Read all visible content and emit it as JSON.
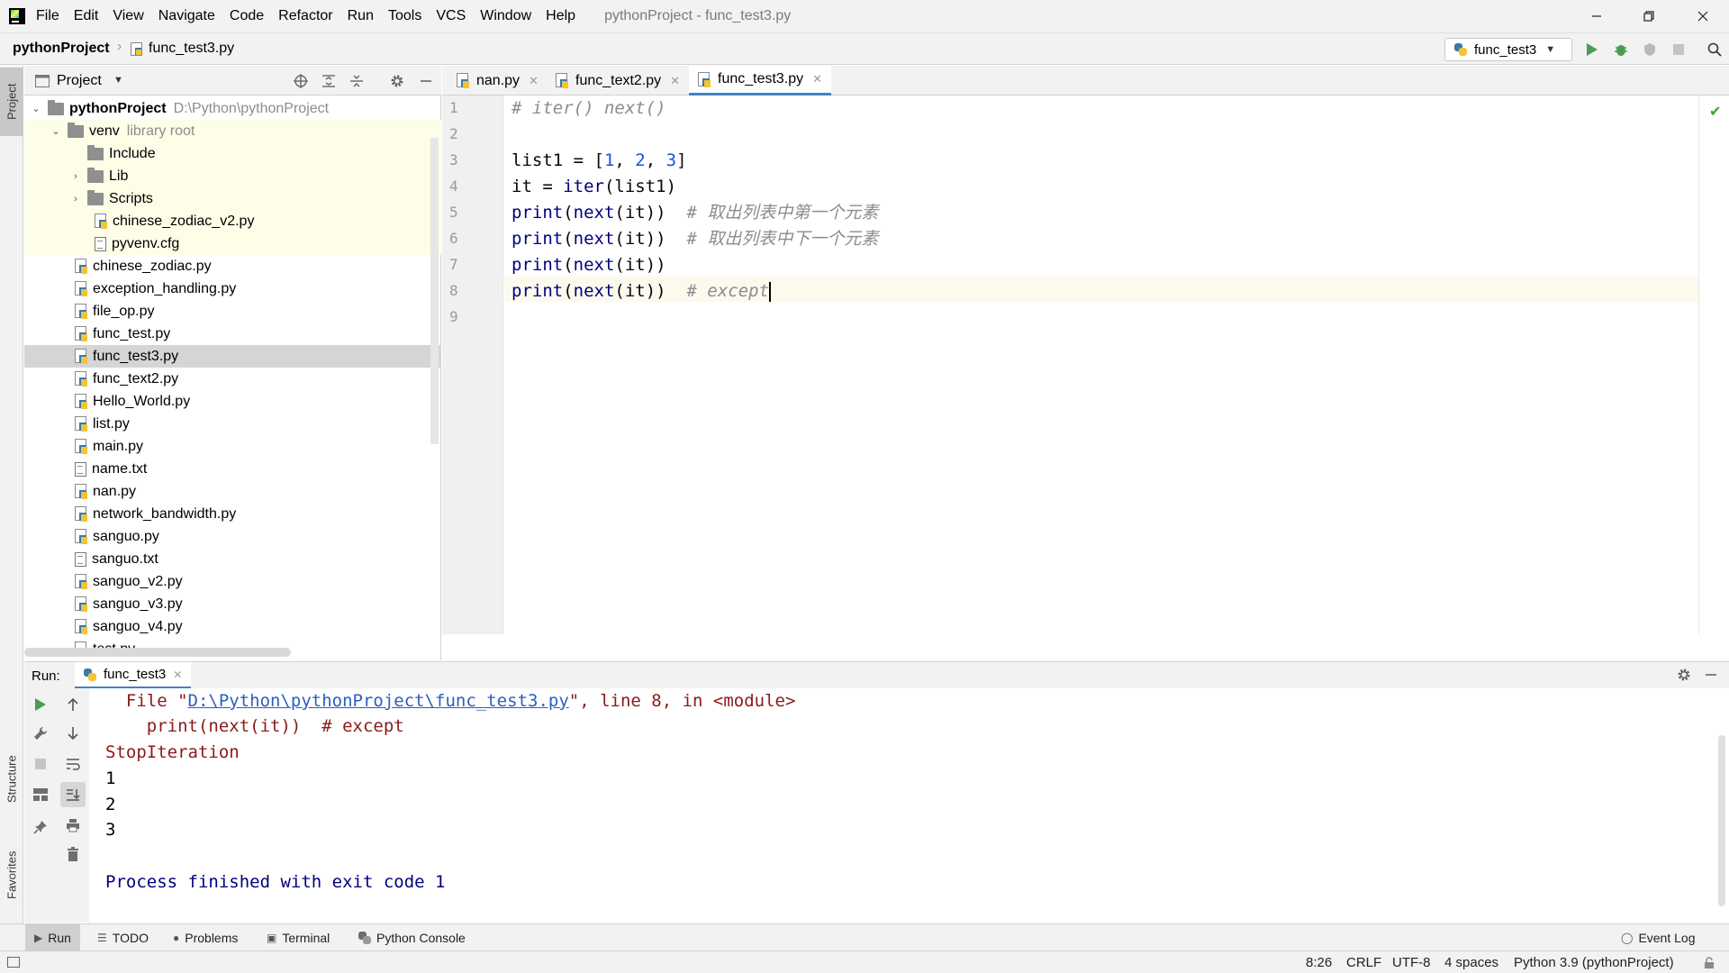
{
  "menubar": {
    "items": [
      "File",
      "Edit",
      "View",
      "Navigate",
      "Code",
      "Refactor",
      "Run",
      "Tools",
      "VCS",
      "Window",
      "Help"
    ],
    "title": "pythonProject - func_test3.py"
  },
  "navbar": {
    "project": "pythonProject",
    "file": "func_test3.py",
    "run_config": "func_test3"
  },
  "left_stripe": {
    "project": "Project",
    "structure": "Structure",
    "favorites": "Favorites"
  },
  "project_panel": {
    "title": "Project",
    "root": {
      "name": "pythonProject",
      "path": "D:\\Python\\pythonProject"
    },
    "venv": {
      "name": "venv",
      "hint": "library root"
    },
    "venv_children": [
      {
        "name": "Include",
        "type": "folder"
      },
      {
        "name": "Lib",
        "type": "folder"
      },
      {
        "name": "Scripts",
        "type": "folder"
      },
      {
        "name": "chinese_zodiac_v2.py",
        "type": "py"
      },
      {
        "name": "pyvenv.cfg",
        "type": "txt"
      }
    ],
    "files": [
      {
        "name": "chinese_zodiac.py",
        "type": "py"
      },
      {
        "name": "exception_handling.py",
        "type": "py"
      },
      {
        "name": "file_op.py",
        "type": "py"
      },
      {
        "name": "func_test.py",
        "type": "py"
      },
      {
        "name": "func_test3.py",
        "type": "py"
      },
      {
        "name": "func_text2.py",
        "type": "py"
      },
      {
        "name": "Hello_World.py",
        "type": "py"
      },
      {
        "name": "list.py",
        "type": "py"
      },
      {
        "name": "main.py",
        "type": "py"
      },
      {
        "name": "name.txt",
        "type": "txt"
      },
      {
        "name": "nan.py",
        "type": "py"
      },
      {
        "name": "network_bandwidth.py",
        "type": "py"
      },
      {
        "name": "sanguo.py",
        "type": "py"
      },
      {
        "name": "sanguo.txt",
        "type": "txt"
      },
      {
        "name": "sanguo_v2.py",
        "type": "py"
      },
      {
        "name": "sanguo_v3.py",
        "type": "py"
      },
      {
        "name": "sanguo_v4.py",
        "type": "py"
      },
      {
        "name": "test.py",
        "type": "py"
      }
    ],
    "selected": "func_test3.py"
  },
  "editor": {
    "tabs": [
      "nan.py",
      "func_text2.py",
      "func_test3.py"
    ],
    "active_tab": "func_test3.py",
    "line_numbers": [
      "1",
      "2",
      "3",
      "4",
      "5",
      "6",
      "7",
      "8",
      "9"
    ],
    "comments": {
      "l1": "# iter() next()",
      "l5": "# 取出列表中第一个元素",
      "l6": "# 取出列表中下一个元素",
      "l8": "# except"
    }
  },
  "run_panel": {
    "label": "Run:",
    "tab": "func_test3",
    "console": {
      "file_prefix": "  File \"",
      "file_link": "D:\\Python\\pythonProject\\func_test3.py",
      "file_suffix": "\", line 8, in <module>",
      "code_line": "    print(next(it))  # except",
      "exception": "StopIteration",
      "out1": "1",
      "out2": "2",
      "out3": "3",
      "finished": "Process finished with exit code 1"
    }
  },
  "bottom_tools": {
    "run": "Run",
    "todo": "TODO",
    "problems": "Problems",
    "terminal": "Terminal",
    "python_console": "Python Console",
    "event_log": "Event Log"
  },
  "statusbar": {
    "position": "8:26",
    "line_sep": "CRLF",
    "encoding": "UTF-8",
    "indent": "4 spaces",
    "interpreter": "Python 3.9 (pythonProject)"
  },
  "colors": {
    "accent": "#4083c9",
    "run_green": "#499c54",
    "comment": "#8c8c8c",
    "keyword_fn": "#000080",
    "number": "#1750eb",
    "error": "#cc0000"
  }
}
